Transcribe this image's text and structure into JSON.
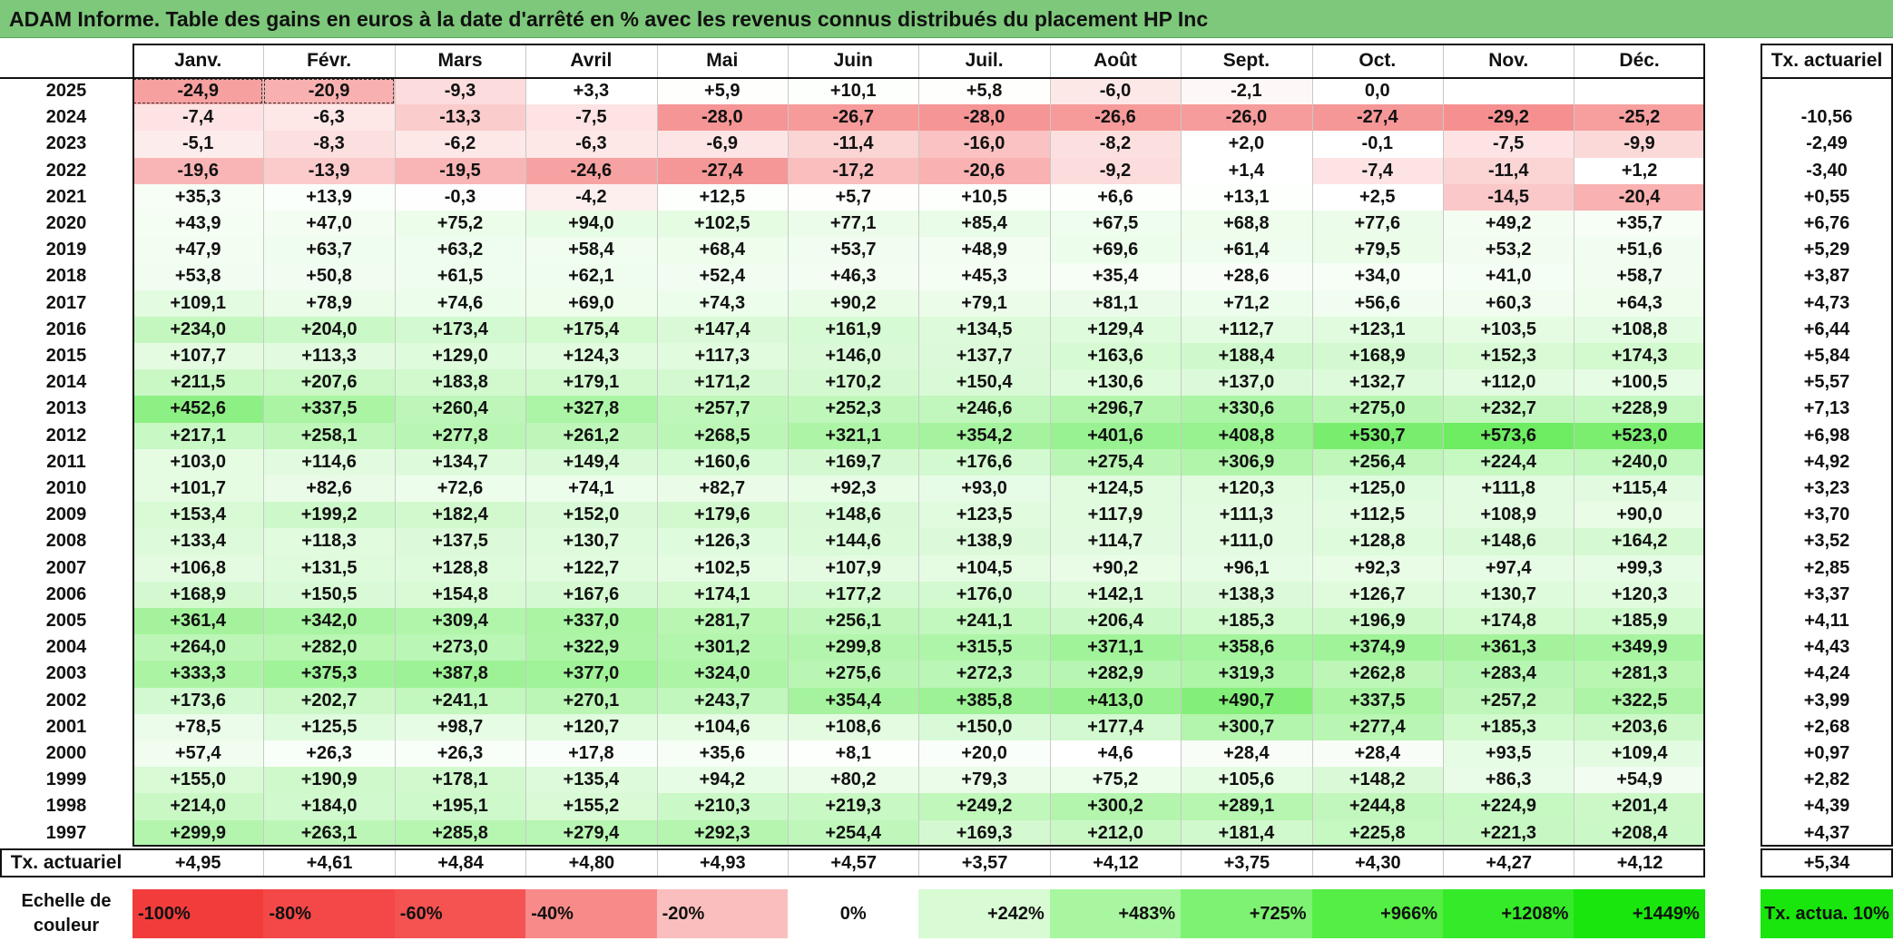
{
  "title": "ADAM Informe. Table des gains en euros à la date d'arrêté en % avec les revenus connus distribués du placement HP Inc",
  "months": [
    "Janv.",
    "Févr.",
    "Mars",
    "Avril",
    "Mai",
    "Juin",
    "Juil.",
    "Août",
    "Sept.",
    "Oct.",
    "Nov.",
    "Déc."
  ],
  "rate_header": "Tx. actuariel",
  "rows": [
    {
      "year": "2025",
      "values": [
        "-24,9",
        "-20,9",
        "-9,3",
        "+3,3",
        "+5,9",
        "+10,1",
        "+5,8",
        "-6,0",
        "-2,1",
        "0,0",
        "",
        ""
      ],
      "rate": ""
    },
    {
      "year": "2024",
      "values": [
        "-7,4",
        "-6,3",
        "-13,3",
        "-7,5",
        "-28,0",
        "-26,7",
        "-28,0",
        "-26,6",
        "-26,0",
        "-27,4",
        "-29,2",
        "-25,2"
      ],
      "rate": "-10,56"
    },
    {
      "year": "2023",
      "values": [
        "-5,1",
        "-8,3",
        "-6,2",
        "-6,3",
        "-6,9",
        "-11,4",
        "-16,0",
        "-8,2",
        "+2,0",
        "-0,1",
        "-7,5",
        "-9,9"
      ],
      "rate": "-2,49"
    },
    {
      "year": "2022",
      "values": [
        "-19,6",
        "-13,9",
        "-19,5",
        "-24,6",
        "-27,4",
        "-17,2",
        "-20,6",
        "-9,2",
        "+1,4",
        "-7,4",
        "-11,4",
        "+1,2"
      ],
      "rate": "-3,40"
    },
    {
      "year": "2021",
      "values": [
        "+35,3",
        "+13,9",
        "-0,3",
        "-4,2",
        "+12,5",
        "+5,7",
        "+10,5",
        "+6,6",
        "+13,1",
        "+2,5",
        "-14,5",
        "-20,4"
      ],
      "rate": "+0,55"
    },
    {
      "year": "2020",
      "values": [
        "+43,9",
        "+47,0",
        "+75,2",
        "+94,0",
        "+102,5",
        "+77,1",
        "+85,4",
        "+67,5",
        "+68,8",
        "+77,6",
        "+49,2",
        "+35,7"
      ],
      "rate": "+6,76"
    },
    {
      "year": "2019",
      "values": [
        "+47,9",
        "+63,7",
        "+63,2",
        "+58,4",
        "+68,4",
        "+53,7",
        "+48,9",
        "+69,6",
        "+61,4",
        "+79,5",
        "+53,2",
        "+51,6"
      ],
      "rate": "+5,29"
    },
    {
      "year": "2018",
      "values": [
        "+53,8",
        "+50,8",
        "+61,5",
        "+62,1",
        "+52,4",
        "+46,3",
        "+45,3",
        "+35,4",
        "+28,6",
        "+34,0",
        "+41,0",
        "+58,7"
      ],
      "rate": "+3,87"
    },
    {
      "year": "2017",
      "values": [
        "+109,1",
        "+78,9",
        "+74,6",
        "+69,0",
        "+74,3",
        "+90,2",
        "+79,1",
        "+81,1",
        "+71,2",
        "+56,6",
        "+60,3",
        "+64,3"
      ],
      "rate": "+4,73"
    },
    {
      "year": "2016",
      "values": [
        "+234,0",
        "+204,0",
        "+173,4",
        "+175,4",
        "+147,4",
        "+161,9",
        "+134,5",
        "+129,4",
        "+112,7",
        "+123,1",
        "+103,5",
        "+108,8"
      ],
      "rate": "+6,44"
    },
    {
      "year": "2015",
      "values": [
        "+107,7",
        "+113,3",
        "+129,0",
        "+124,3",
        "+117,3",
        "+146,0",
        "+137,7",
        "+163,6",
        "+188,4",
        "+168,9",
        "+152,3",
        "+174,3"
      ],
      "rate": "+5,84"
    },
    {
      "year": "2014",
      "values": [
        "+211,5",
        "+207,6",
        "+183,8",
        "+179,1",
        "+171,2",
        "+170,2",
        "+150,4",
        "+130,6",
        "+137,0",
        "+132,7",
        "+112,0",
        "+100,5"
      ],
      "rate": "+5,57"
    },
    {
      "year": "2013",
      "values": [
        "+452,6",
        "+337,5",
        "+260,4",
        "+327,8",
        "+257,7",
        "+252,3",
        "+246,6",
        "+296,7",
        "+330,6",
        "+275,0",
        "+232,7",
        "+228,9"
      ],
      "rate": "+7,13"
    },
    {
      "year": "2012",
      "values": [
        "+217,1",
        "+258,1",
        "+277,8",
        "+261,2",
        "+268,5",
        "+321,1",
        "+354,2",
        "+401,6",
        "+408,8",
        "+530,7",
        "+573,6",
        "+523,0"
      ],
      "rate": "+6,98"
    },
    {
      "year": "2011",
      "values": [
        "+103,0",
        "+114,6",
        "+134,7",
        "+149,4",
        "+160,6",
        "+169,7",
        "+176,6",
        "+275,4",
        "+306,9",
        "+256,4",
        "+224,4",
        "+240,0"
      ],
      "rate": "+4,92"
    },
    {
      "year": "2010",
      "values": [
        "+101,7",
        "+82,6",
        "+72,6",
        "+74,1",
        "+82,7",
        "+92,3",
        "+93,0",
        "+124,5",
        "+120,3",
        "+125,0",
        "+111,8",
        "+115,4"
      ],
      "rate": "+3,23"
    },
    {
      "year": "2009",
      "values": [
        "+153,4",
        "+199,2",
        "+182,4",
        "+152,0",
        "+179,6",
        "+148,6",
        "+123,5",
        "+117,9",
        "+111,3",
        "+112,5",
        "+108,9",
        "+90,0"
      ],
      "rate": "+3,70"
    },
    {
      "year": "2008",
      "values": [
        "+133,4",
        "+118,3",
        "+137,5",
        "+130,7",
        "+126,3",
        "+144,6",
        "+138,9",
        "+114,7",
        "+111,0",
        "+128,8",
        "+148,6",
        "+164,2"
      ],
      "rate": "+3,52"
    },
    {
      "year": "2007",
      "values": [
        "+106,8",
        "+131,5",
        "+128,8",
        "+122,7",
        "+102,5",
        "+107,9",
        "+104,5",
        "+90,2",
        "+96,1",
        "+92,3",
        "+97,4",
        "+99,3"
      ],
      "rate": "+2,85"
    },
    {
      "year": "2006",
      "values": [
        "+168,9",
        "+150,5",
        "+154,8",
        "+167,6",
        "+174,1",
        "+177,2",
        "+176,0",
        "+142,1",
        "+138,3",
        "+126,7",
        "+130,7",
        "+120,3"
      ],
      "rate": "+3,37"
    },
    {
      "year": "2005",
      "values": [
        "+361,4",
        "+342,0",
        "+309,4",
        "+337,0",
        "+281,7",
        "+256,1",
        "+241,1",
        "+206,4",
        "+185,3",
        "+196,9",
        "+174,8",
        "+185,9"
      ],
      "rate": "+4,11"
    },
    {
      "year": "2004",
      "values": [
        "+264,0",
        "+282,0",
        "+273,0",
        "+322,9",
        "+301,2",
        "+299,8",
        "+315,5",
        "+371,1",
        "+358,6",
        "+374,9",
        "+361,3",
        "+349,9"
      ],
      "rate": "+4,43"
    },
    {
      "year": "2003",
      "values": [
        "+333,3",
        "+375,3",
        "+387,8",
        "+377,0",
        "+324,0",
        "+275,6",
        "+272,3",
        "+282,9",
        "+319,3",
        "+262,8",
        "+283,4",
        "+281,3"
      ],
      "rate": "+4,24"
    },
    {
      "year": "2002",
      "values": [
        "+173,6",
        "+202,7",
        "+241,1",
        "+270,1",
        "+243,7",
        "+354,4",
        "+385,8",
        "+413,0",
        "+490,7",
        "+337,5",
        "+257,2",
        "+322,5"
      ],
      "rate": "+3,99"
    },
    {
      "year": "2001",
      "values": [
        "+78,5",
        "+125,5",
        "+98,7",
        "+120,7",
        "+104,6",
        "+108,6",
        "+150,0",
        "+177,4",
        "+300,7",
        "+277,4",
        "+185,3",
        "+203,6"
      ],
      "rate": "+2,68"
    },
    {
      "year": "2000",
      "values": [
        "+57,4",
        "+26,3",
        "+26,3",
        "+17,8",
        "+35,6",
        "+8,1",
        "+20,0",
        "+4,6",
        "+28,4",
        "+28,4",
        "+93,5",
        "+109,4"
      ],
      "rate": "+0,97"
    },
    {
      "year": "1999",
      "values": [
        "+155,0",
        "+190,9",
        "+178,1",
        "+135,4",
        "+94,2",
        "+80,2",
        "+79,3",
        "+75,2",
        "+105,6",
        "+148,2",
        "+86,3",
        "+54,9"
      ],
      "rate": "+2,82"
    },
    {
      "year": "1998",
      "values": [
        "+214,0",
        "+184,0",
        "+195,1",
        "+155,2",
        "+210,3",
        "+219,3",
        "+249,2",
        "+300,2",
        "+289,1",
        "+244,8",
        "+224,9",
        "+201,4"
      ],
      "rate": "+4,39"
    },
    {
      "year": "1997",
      "values": [
        "+299,9",
        "+263,1",
        "+285,8",
        "+279,4",
        "+292,3",
        "+254,4",
        "+169,3",
        "+212,0",
        "+181,4",
        "+225,8",
        "+221,3",
        "+208,4"
      ],
      "rate": "+4,37"
    }
  ],
  "footer": {
    "label": "Tx. actuariel",
    "values": [
      "+4,95",
      "+4,61",
      "+4,84",
      "+4,80",
      "+4,93",
      "+4,57",
      "+3,57",
      "+4,12",
      "+3,75",
      "+4,30",
      "+4,27",
      "+4,12"
    ],
    "rate": "+5,34"
  },
  "scale": {
    "label": "Echelle de couleur",
    "items": [
      {
        "text": "-100%",
        "color": "#f23c3c",
        "align": "left"
      },
      {
        "text": "-80%",
        "color": "#f44848",
        "align": "left"
      },
      {
        "text": "-60%",
        "color": "#f55252",
        "align": "left"
      },
      {
        "text": "-40%",
        "color": "#f88a8a",
        "align": "left"
      },
      {
        "text": "-20%",
        "color": "#fbbebe",
        "align": "left"
      },
      {
        "text": "0%",
        "color": "#ffffff",
        "align": "center"
      },
      {
        "text": "+242%",
        "color": "#d8fbd4",
        "align": "right"
      },
      {
        "text": "+483%",
        "color": "#a8f7a0",
        "align": "right"
      },
      {
        "text": "+725%",
        "color": "#7ef272",
        "align": "right"
      },
      {
        "text": "+966%",
        "color": "#55ee45",
        "align": "right"
      },
      {
        "text": "+1208%",
        "color": "#35ea28",
        "align": "right"
      },
      {
        "text": "+1449%",
        "color": "#18e60c",
        "align": "right"
      }
    ],
    "rate_label": "Tx. actua. 10%",
    "rate_color": "#18e60c"
  },
  "colors": {
    "title_bg": "#7dc87a",
    "negative_max": "#f23c3c",
    "positive_max": "#18e60c"
  }
}
